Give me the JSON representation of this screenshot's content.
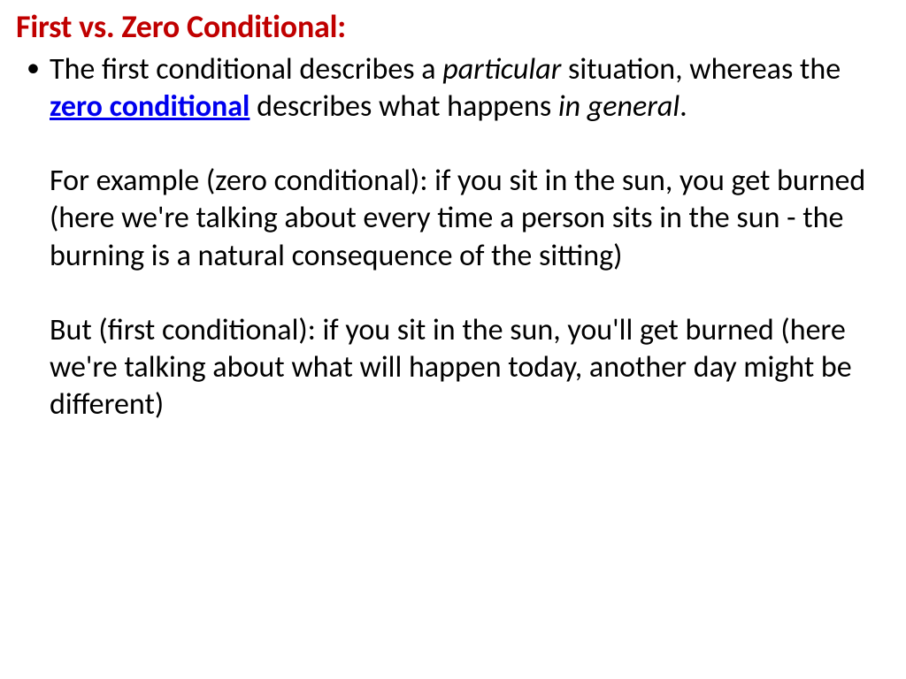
{
  "heading": "First vs. Zero Conditional:",
  "content": {
    "p1_part1": "The first conditional describes a ",
    "p1_italic1": "particular",
    "p1_part2": " situation, whereas the ",
    "p1_link": "zero conditional",
    "p1_part3": " describes what happens ",
    "p1_italic2": "in general",
    "p1_part4": ".",
    "p2": "For example (zero conditional): if you sit in the sun, you get burned (here we're talking about every time a person sits in the sun - the burning is a natural consequence of the sitting)",
    "p3": "But (first conditional): if you sit in the sun, you'll get burned (here we're talking about what will happen today, another day might be different)"
  },
  "colors": {
    "heading": "#c00000",
    "link": "#0000ee",
    "body": "#000000"
  }
}
